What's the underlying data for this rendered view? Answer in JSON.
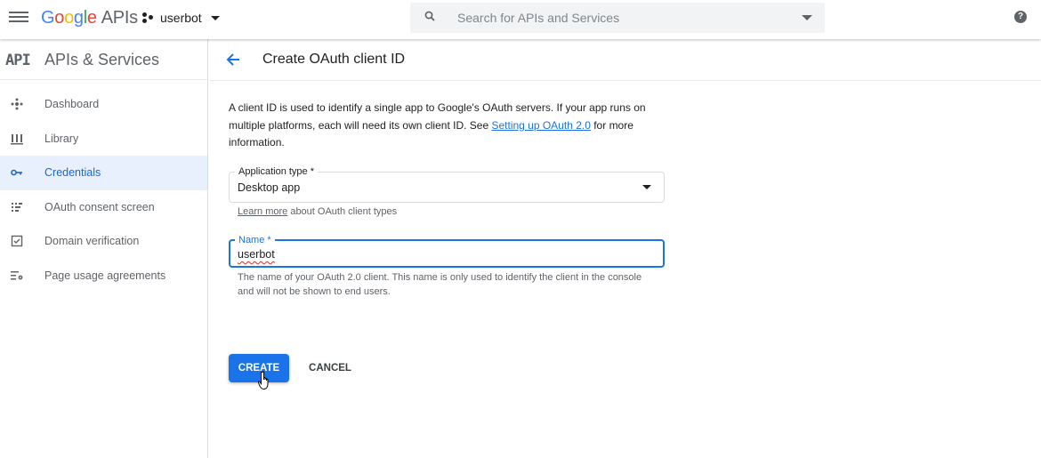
{
  "topbar": {
    "logo_brand": "Google",
    "logo_product": "APIs",
    "project_name": "userbot",
    "search_placeholder": "Search for APIs and Services",
    "help_label": "?"
  },
  "sidebar": {
    "badge": "API",
    "title": "APIs & Services",
    "items": [
      {
        "label": "Dashboard",
        "icon": "dashboard-icon"
      },
      {
        "label": "Library",
        "icon": "library-icon"
      },
      {
        "label": "Credentials",
        "icon": "key-icon",
        "active": true
      },
      {
        "label": "OAuth consent screen",
        "icon": "consent-screen-icon"
      },
      {
        "label": "Domain verification",
        "icon": "domain-verification-icon"
      },
      {
        "label": "Page usage agreements",
        "icon": "settings-list-icon"
      }
    ]
  },
  "header": {
    "title": "Create OAuth client ID"
  },
  "form": {
    "description_pre": "A client ID is used to identify a single app to Google's OAuth servers. If your app runs on multiple platforms, each will need its own client ID. See ",
    "description_link": "Setting up OAuth 2.0",
    "description_post": " for more information.",
    "app_type_label": "Application type *",
    "app_type_value": "Desktop app",
    "learn_more_link": "Learn more",
    "learn_more_text": " about OAuth client types",
    "name_label": "Name *",
    "name_value": "userbot",
    "name_hint": "The name of your OAuth 2.0 client. This name is only used to identify the client in the console and will not be shown to end users."
  },
  "actions": {
    "create_label": "CREATE",
    "cancel_label": "CANCEL"
  },
  "colors": {
    "accent": "#1a73e8",
    "active_bg": "#e8f0fe",
    "error_underline": "#d93025"
  }
}
